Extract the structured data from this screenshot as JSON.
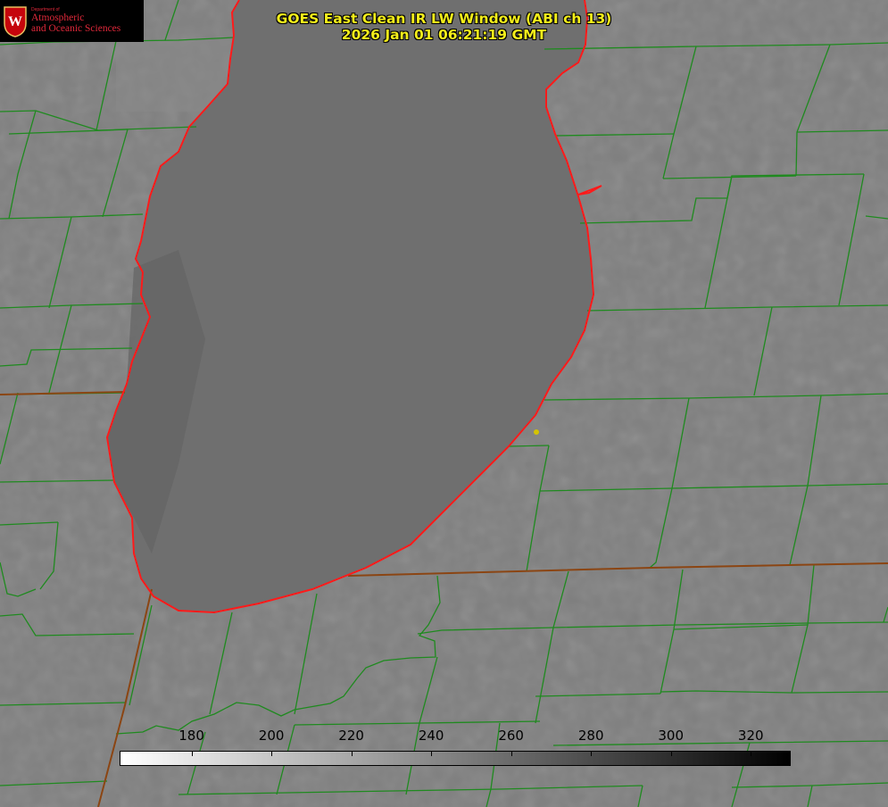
{
  "title": {
    "line1": "GOES East Clean IR LW Window (ABI ch 13)",
    "line2": "2026 Jan 01 06:21:19 GMT"
  },
  "logo": {
    "department": "Department of",
    "line1": "Atmospheric",
    "line2": "and Oceanic Sciences",
    "seal_letter": "W"
  },
  "colorbar": {
    "min": 162,
    "max": 330,
    "ticks": [
      "180",
      "200",
      "220",
      "240",
      "260",
      "280",
      "300",
      "320"
    ],
    "tick_values": [
      180,
      200,
      220,
      240,
      260,
      280,
      300,
      320
    ],
    "low_color": "#ffffff",
    "high_color": "#000000"
  },
  "colors": {
    "title_text": "#f4ee1a",
    "county_lines": "#1f8a1f",
    "lake_shore": "#ff1a1a",
    "state_border": "#8b4513",
    "station_marker": "#d4c400",
    "background": "#7d7d7d",
    "lake_fill": "#6e6e6e"
  }
}
